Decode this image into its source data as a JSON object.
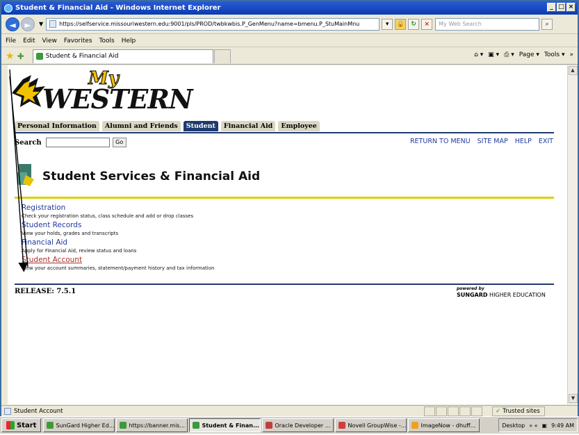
{
  "window": {
    "title": "Student & Financial Aid - Windows Internet Explorer",
    "min": "_",
    "max": "□",
    "close": "×"
  },
  "toolbar": {
    "back": "◄",
    "forward": "►",
    "dropdown": "▼",
    "address": "https://selfservice.missouriwestern.edu:9001/pls/PROD/twbkwbis.P_GenMenu?name=bmenu.P_StuMainMnu",
    "search_placeholder": "My Web Search"
  },
  "menubar": [
    "File",
    "Edit",
    "View",
    "Favorites",
    "Tools",
    "Help"
  ],
  "tab": {
    "title": "Student & Financial Aid"
  },
  "commandbar": [
    "⌂ ▾",
    "▣ ▾",
    "⎙ ▾",
    "Page ▾",
    "Tools ▾",
    "»"
  ],
  "page": {
    "logo_my": "My",
    "logo_western": "WESTERN",
    "nav_tabs": [
      "Personal Information",
      "Alumni and Friends",
      "Student",
      "Financial Aid",
      "Employee"
    ],
    "active_tab": "Student",
    "search_label": "Search",
    "go_label": "Go",
    "top_links": [
      "RETURN TO MENU",
      "SITE MAP",
      "HELP",
      "EXIT"
    ],
    "section_title": "Student Services & Financial Aid",
    "menu_items": [
      {
        "label": "Registration",
        "desc": "Check your registration status, class schedule and add or drop classes"
      },
      {
        "label": "Student Records",
        "desc": "View your holds, grades and transcripts"
      },
      {
        "label": "Financial Aid",
        "desc": "Apply for Financial Aid, review status and loans"
      },
      {
        "label": "Student Account",
        "desc": "View your account summaries, statement/payment history and tax information"
      }
    ],
    "release": "RELEASE: 7.5.1",
    "powered_by": "powered by",
    "sungard_bold": "SUNGARD",
    "sungard_rest": " HIGHER EDUCATION"
  },
  "statusbar": {
    "text": "Student Account",
    "zone": "Trusted sites"
  },
  "taskbar": {
    "start": "Start",
    "tasks": [
      {
        "label": "SunGard Higher Ed...",
        "color": "#3c9a3c"
      },
      {
        "label": "https://banner.mis...",
        "color": "#3c9a3c"
      },
      {
        "label": "Student & Finan...",
        "color": "#3c9a3c"
      },
      {
        "label": "Oracle Developer ...",
        "color": "#c04040"
      },
      {
        "label": "Novell GroupWise -...",
        "color": "#d23c3c"
      },
      {
        "label": "ImageNow - dhuff...",
        "color": "#f0a020"
      }
    ],
    "active_task": 2,
    "desktop": "Desktop",
    "tray_more": "» «",
    "time": "9:49 AM"
  }
}
